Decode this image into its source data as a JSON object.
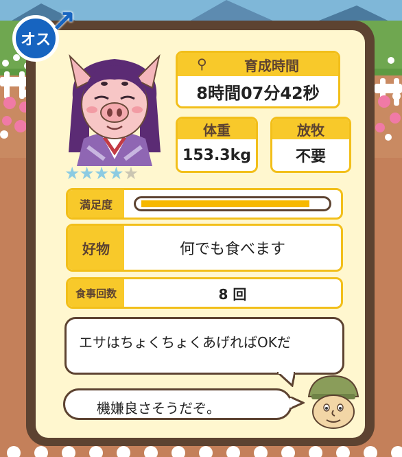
{
  "gender": {
    "label": "オス",
    "icon": "male-symbol-icon"
  },
  "rating": {
    "stars_total": 5,
    "stars_filled": 4
  },
  "stars": [
    "★",
    "★",
    "★",
    "★",
    "★"
  ],
  "growth_time": {
    "label": "育成時間",
    "value": "8時間07分42秒",
    "icon": "whistle-icon"
  },
  "weight": {
    "label": "体重",
    "value": "153.3kg"
  },
  "grazing": {
    "label": "放牧",
    "value": "不要"
  },
  "satisfaction": {
    "label": "満足度",
    "level": 0.92
  },
  "favorite_food": {
    "label": "好物",
    "value": "何でも食べます"
  },
  "meal_count": {
    "label": "食事回数",
    "value": "8 回"
  },
  "dialogue": {
    "line1": "エサはちょくちょくあげればOKだ",
    "line2": "機嫌良さそうだぞ。"
  },
  "colors": {
    "frame": "#5d4331",
    "panel": "#fff7cf",
    "accent": "#f8c92a",
    "gauge": "#f6b800",
    "male_badge": "#1764c0",
    "star_on": "#8ccbe2",
    "star_off": "#cbc6b2"
  }
}
